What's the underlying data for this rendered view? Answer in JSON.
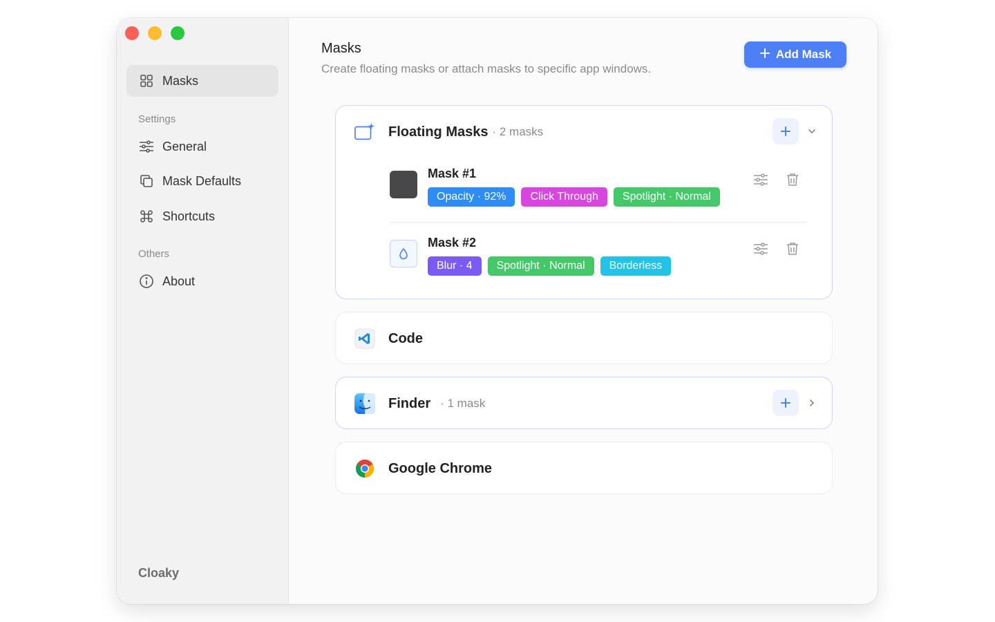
{
  "sidebar": {
    "items": [
      {
        "label": "Masks",
        "icon": "grid-icon"
      },
      {
        "label": "General",
        "icon": "sliders-icon"
      },
      {
        "label": "Mask Defaults",
        "icon": "copy-icon"
      },
      {
        "label": "Shortcuts",
        "icon": "command-icon"
      },
      {
        "label": "About",
        "icon": "info-icon"
      }
    ],
    "sections": {
      "settings": "Settings",
      "others": "Others"
    },
    "brand": "Cloaky"
  },
  "header": {
    "title": "Masks",
    "subtitle": "Create floating masks or attach masks to specific app windows.",
    "add_label": "Add Mask"
  },
  "groups": {
    "floating": {
      "title": "Floating Masks",
      "count": "· 2 masks",
      "masks": [
        {
          "name": "Mask #1",
          "tags": [
            "Opacity · 92%",
            "Click Through",
            "Spotlight · Normal"
          ]
        },
        {
          "name": "Mask #2",
          "tags": [
            "Blur · 4",
            "Spotlight · Normal",
            "Borderless"
          ]
        }
      ]
    },
    "code": {
      "title": "Code"
    },
    "finder": {
      "title": "Finder",
      "count": "· 1 mask"
    },
    "chrome": {
      "title": "Google Chrome"
    }
  },
  "colors": {
    "accent": "#4d7ff7",
    "tag_blue": "#2e8cf6",
    "tag_magenta": "#d846e0",
    "tag_green": "#45c86a",
    "tag_purple": "#7a5cf5",
    "tag_cyan": "#22c3e6"
  }
}
